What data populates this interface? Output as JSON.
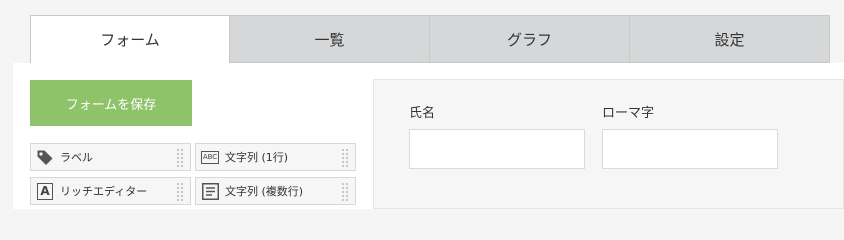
{
  "tabs": [
    {
      "label": "フォーム",
      "active": true
    },
    {
      "label": "一覧",
      "active": false
    },
    {
      "label": "グラフ",
      "active": false
    },
    {
      "label": "設定",
      "active": false
    }
  ],
  "toolbar": {
    "save_label": "フォームを保存"
  },
  "palette": [
    {
      "label": "ラベル",
      "icon": "tag-icon"
    },
    {
      "label": "文字列 (1行)",
      "icon": "abc-text-icon",
      "icon_text": "ABC"
    },
    {
      "label": "リッチエディター",
      "icon": "rich-editor-icon",
      "icon_text": "A"
    },
    {
      "label": "文字列 (複数行)",
      "icon": "multiline-text-icon"
    }
  ],
  "form": {
    "fields": [
      {
        "label": "氏名",
        "value": ""
      },
      {
        "label": "ローマ字",
        "value": ""
      }
    ]
  },
  "colors": {
    "accent": "#8fc36a",
    "tab_inactive": "#d6d7d8",
    "canvas": "#f6f6f6"
  }
}
